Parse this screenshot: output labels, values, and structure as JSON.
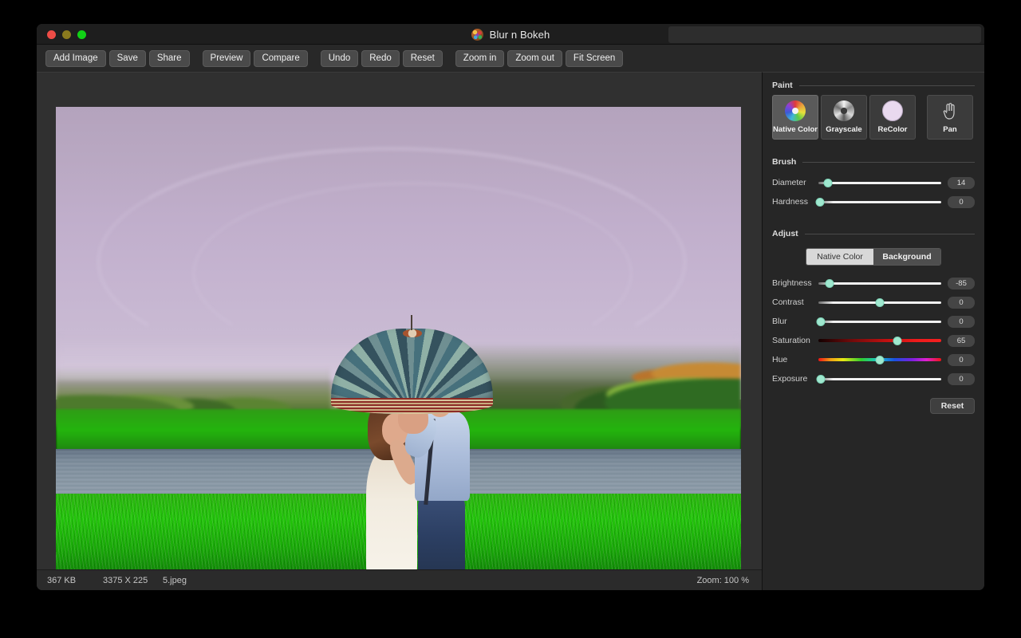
{
  "window": {
    "title": "Blur n Bokeh",
    "app_icon": "palette-icon",
    "traffic_lights": [
      "close",
      "minimize",
      "maximize"
    ]
  },
  "toolbar": {
    "groups": [
      {
        "buttons": [
          {
            "name": "add-image",
            "label": "Add Image"
          },
          {
            "name": "save",
            "label": "Save"
          },
          {
            "name": "share",
            "label": "Share"
          }
        ]
      },
      {
        "buttons": [
          {
            "name": "preview",
            "label": "Preview"
          },
          {
            "name": "compare",
            "label": "Compare"
          }
        ]
      },
      {
        "buttons": [
          {
            "name": "undo",
            "label": "Undo"
          },
          {
            "name": "redo",
            "label": "Redo"
          },
          {
            "name": "reset",
            "label": "Reset"
          }
        ]
      },
      {
        "buttons": [
          {
            "name": "zoom-in",
            "label": "Zoom in"
          },
          {
            "name": "zoom-out",
            "label": "Zoom out"
          },
          {
            "name": "fit-screen",
            "label": "Fit Screen"
          }
        ]
      }
    ]
  },
  "canvas": {
    "image_description": "Couple kissing under a teal umbrella beside a lake with green grass and a rainbow in a purple sky"
  },
  "statusbar": {
    "file_size": "367 KB",
    "dimensions": "3375 X 225",
    "filename": "5.jpeg",
    "zoom": "Zoom: 100 %"
  },
  "panel": {
    "paint": {
      "title": "Paint",
      "tools": [
        {
          "name": "native-color",
          "label": "Native Color",
          "icon": "color-wheel-icon",
          "active": true
        },
        {
          "name": "grayscale",
          "label": "Grayscale",
          "icon": "grayscale-wheel-icon",
          "active": false
        },
        {
          "name": "recolor",
          "label": "ReColor",
          "icon": "color-swatch-icon",
          "active": false
        },
        {
          "name": "pan",
          "label": "Pan",
          "icon": "hand-icon",
          "active": false
        }
      ]
    },
    "brush": {
      "title": "Brush",
      "sliders": [
        {
          "name": "diameter",
          "label": "Diameter",
          "value": "14",
          "percent": 8,
          "track": "plain"
        },
        {
          "name": "hardness",
          "label": "Hardness",
          "value": "0",
          "percent": 0,
          "track": "plain"
        }
      ]
    },
    "adjust": {
      "title": "Adjust",
      "segmented": {
        "options": [
          "Native Color",
          "Background"
        ],
        "selected": "Native Color"
      },
      "sliders": [
        {
          "name": "brightness",
          "label": "Brightness",
          "value": "-85",
          "percent": 9,
          "track": "plain"
        },
        {
          "name": "contrast",
          "label": "Contrast",
          "value": "0",
          "percent": 50,
          "track": "plain"
        },
        {
          "name": "blur",
          "label": "Blur",
          "value": "0",
          "percent": 2,
          "track": "plain"
        },
        {
          "name": "saturation",
          "label": "Saturation",
          "value": "65",
          "percent": 64,
          "track": "sat"
        },
        {
          "name": "hue",
          "label": "Hue",
          "value": "0",
          "percent": 50,
          "track": "hue"
        },
        {
          "name": "exposure",
          "label": "Exposure",
          "value": "0",
          "percent": 2,
          "track": "plain"
        }
      ],
      "reset_label": "Reset"
    }
  },
  "colors": {
    "window_bg": "#282828",
    "panel_bg": "#262626",
    "titlebar_bg": "#1e1e1e",
    "button_bg": "#4a4a4a",
    "slider_knob": "#9fe8cf",
    "accent_selected": "#d8d8d8"
  }
}
